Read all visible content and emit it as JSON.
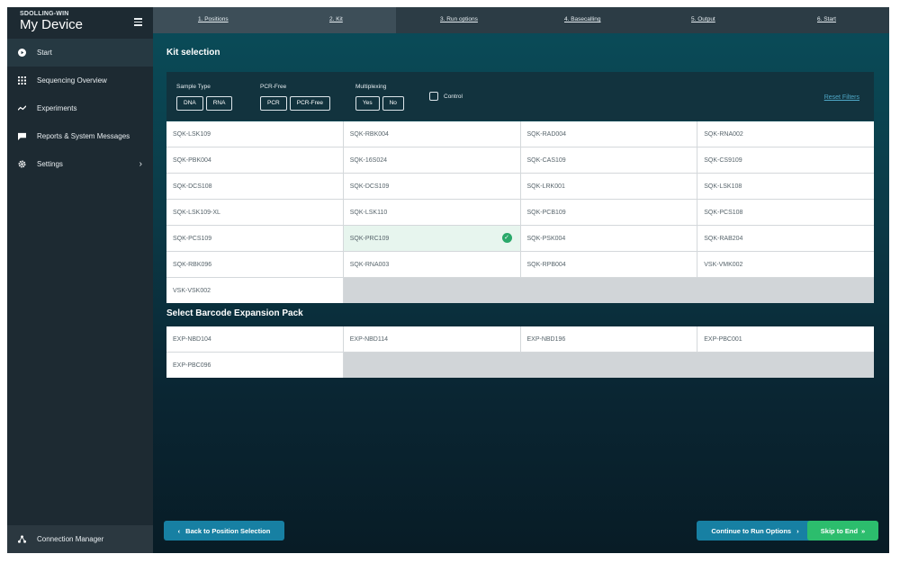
{
  "app": {
    "org": "SDOLLING-WIN",
    "device": "My Device"
  },
  "sidebar": {
    "items": [
      {
        "label": "Start"
      },
      {
        "label": "Sequencing Overview"
      },
      {
        "label": "Experiments"
      },
      {
        "label": "Reports & System Messages"
      },
      {
        "label": "Settings"
      }
    ],
    "footer": {
      "label": "Connection Manager"
    }
  },
  "steps": [
    {
      "label": "1. Positions"
    },
    {
      "label": "2. Kit"
    },
    {
      "label": "3. Run options"
    },
    {
      "label": "4. Basecalling"
    },
    {
      "label": "5. Output"
    },
    {
      "label": "6. Start"
    }
  ],
  "kit_selection": {
    "title": "Kit selection",
    "filters": {
      "sample_type": {
        "label": "Sample Type",
        "options": [
          "DNA",
          "RNA"
        ]
      },
      "pcr_free": {
        "label": "PCR-Free",
        "options": [
          "PCR",
          "PCR-Free"
        ]
      },
      "multiplexing": {
        "label": "Multiplexing",
        "options": [
          "Yes",
          "No"
        ]
      },
      "control": {
        "label": "Control"
      },
      "reset": "Reset Filters"
    },
    "kits": [
      "SQK-LSK109",
      "SQK-RBK004",
      "SQK-RAD004",
      "SQK-RNA002",
      "SQK-PBK004",
      "SQK-16S024",
      "SQK-CAS109",
      "SQK-CS9109",
      "SQK-DCS108",
      "SQK-DCS109",
      "SQK-LRK001",
      "SQK-LSK108",
      "SQK-LSK109-XL",
      "SQK-LSK110",
      "SQK-PCB109",
      "SQK-PCS108",
      "SQK-PCS109",
      "SQK-PRC109",
      "SQK-PSK004",
      "SQK-RAB204",
      "SQK-RBK096",
      "SQK-RNA003",
      "SQK-RPB004",
      "VSK-VMK002",
      "VSK-VSK002"
    ],
    "selected_kit": "SQK-PRC109"
  },
  "barcode": {
    "title": "Select Barcode Expansion Pack",
    "packs": [
      "EXP-NBD104",
      "EXP-NBD114",
      "EXP-NBD196",
      "EXP-PBC001",
      "EXP-PBC096"
    ]
  },
  "footer_buttons": {
    "back": "Back to Position Selection",
    "continue": "Continue to Run Options",
    "skip": "Skip to End"
  },
  "colors": {
    "sidebar": "#1d2a32",
    "primary_button": "#1780a3",
    "skip_button": "#2cbd6d",
    "selected_check": "#2aa86a",
    "link": "#4ea7c6"
  }
}
